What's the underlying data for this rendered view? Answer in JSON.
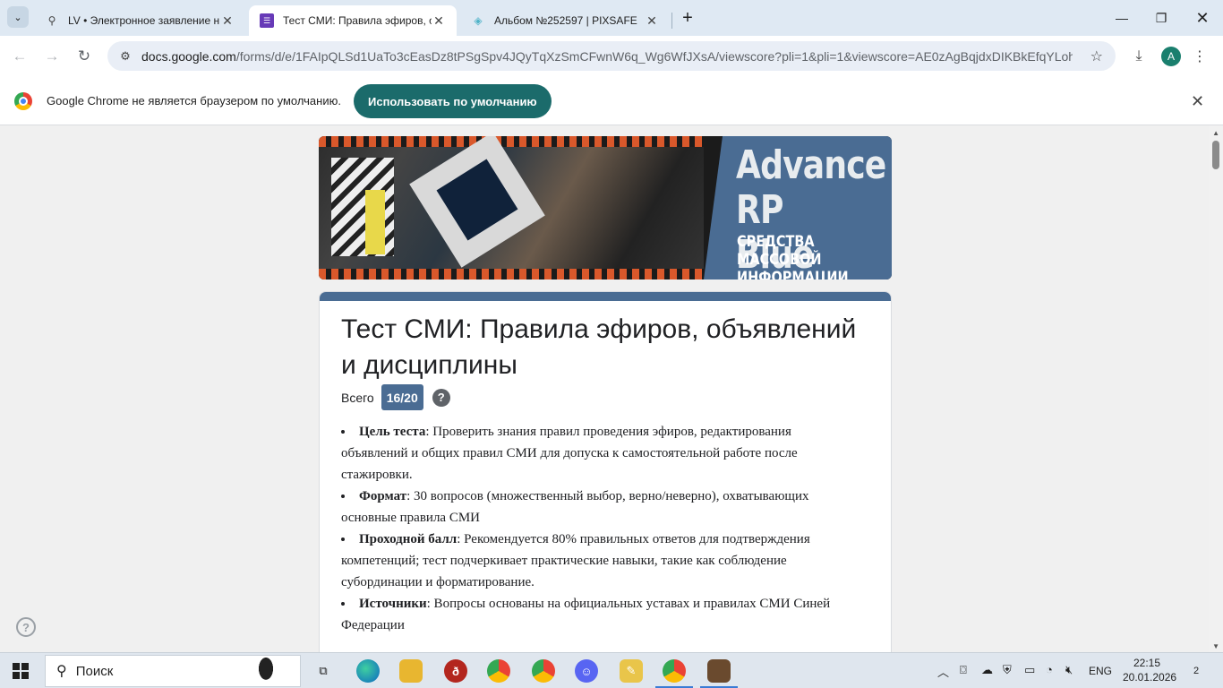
{
  "browser": {
    "tabs": [
      {
        "title": "LV • Электронное заявление н",
        "icon": "lv-icon"
      },
      {
        "title": "Тест СМИ: Правила эфиров, о",
        "icon": "google-forms-icon",
        "active": true
      },
      {
        "title": "Альбом №252597 | PIXSAFE",
        "icon": "pixsafe-icon"
      }
    ],
    "url_host": "docs.google.com",
    "url_path": "/forms/d/e/1FAIpQLSd1UaTo3cEasDz8tPSgSpv4JQyTqXzSmCFwnW6q_Wg6WfJXsA/viewscore?pli=1&pli=1&viewscore=AE0zAgBqjdxDIKBkEfqYLohaUy...",
    "avatar_letter": "A"
  },
  "infobar": {
    "message": "Google Chrome не является браузером по умолчанию.",
    "button": "Использовать по умолчанию"
  },
  "banner": {
    "title_line1": "Advance",
    "title_line2": "RP Blue",
    "subtitle_line1": "СРЕДСТВА МАССОВОЙ",
    "subtitle_line2": "ИНФОРМАЦИИ"
  },
  "form": {
    "title": "Тест СМИ: Правила эфиров, объявлений и дисциплины",
    "score_label": "Всего",
    "score_value": "16/20",
    "items": [
      {
        "term": "Цель теста",
        "text": ": Проверить знания правил проведения эфиров, редактирования объявлений и общих правил СМИ для допуска к самостоятельной работе после стажировки."
      },
      {
        "term": "Формат",
        "text": ": 30 вопросов (множественный выбор, верно/неверно), охватывающих основные правила СМИ"
      },
      {
        "term": "Проходной балл",
        "text": ": Рекомендуется 80% правильных ответов для подтверждения компетенций; тест подчеркивает практические навыки, такие как соблюдение субординации и форматирование."
      },
      {
        "term": "Источники",
        "text": ": Вопросы основаны на официальных уставах и правилах СМИ Синей Федерации"
      }
    ]
  },
  "taskbar": {
    "search_label": "Поиск",
    "lang": "ENG",
    "time": "22:15",
    "date": "20.01.2026",
    "notifications": "2"
  }
}
